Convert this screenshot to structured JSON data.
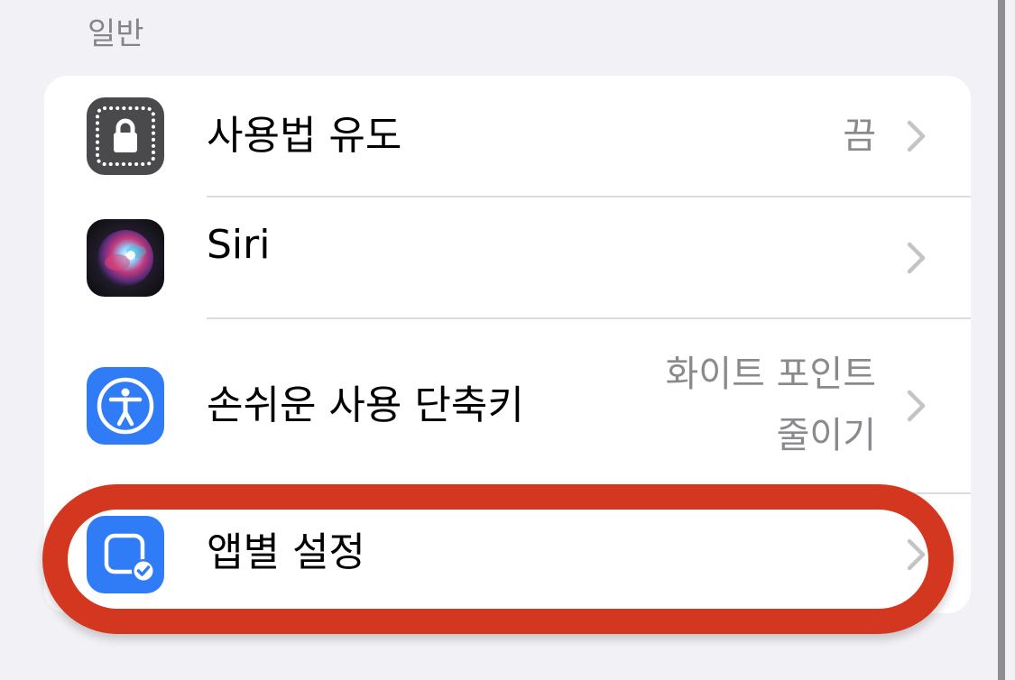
{
  "section": {
    "title": "일반"
  },
  "rows": [
    {
      "label": "사용법 유도",
      "value": "끔",
      "icon": "guided-access-lock-icon",
      "icon_color": "#4a4a4c"
    },
    {
      "label": "Siri",
      "value": "",
      "icon": "siri-orb-icon",
      "icon_color": "#1c1c22"
    },
    {
      "label": "손쉬운 사용 단축키",
      "value_line1": "화이트 포인트",
      "value_line2": "줄이기",
      "icon": "accessibility-person-icon",
      "icon_color": "#2f7cf6"
    },
    {
      "label": "앱별 설정",
      "value": "",
      "icon": "app-checkmark-icon",
      "icon_color": "#2f7cf6"
    }
  ],
  "highlight": {
    "target": "앱별 설정",
    "color": "#d4371f"
  },
  "colors": {
    "background": "#f2f2f6",
    "secondary_text": "#8a8a8e",
    "chevron": "#c4c4c7"
  }
}
